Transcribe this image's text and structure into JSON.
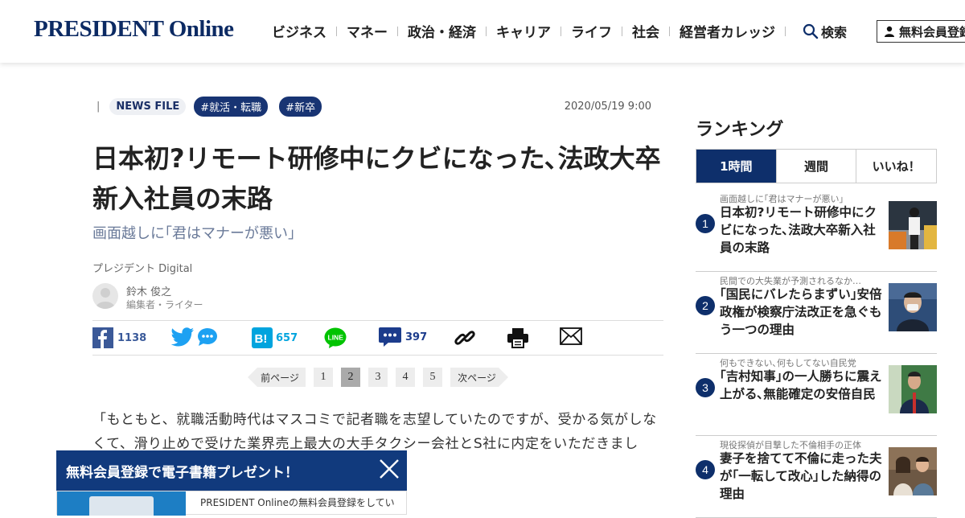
{
  "header": {
    "logo": "PRESIDENT Online",
    "nav": [
      "ビジネス",
      "マネー",
      "政治・経済",
      "キャリア",
      "ライフ",
      "社会",
      "経営者カレッジ"
    ],
    "search_label": "検索",
    "register_label": "無料会員登録"
  },
  "article": {
    "category": "NEWS FILE",
    "tags": [
      "#就活・転職",
      "#新卒"
    ],
    "date": "2020/05/19 9:00",
    "title": "日本初?リモート研修中にクビになった､法政大卒新入社員の末路",
    "subtitle": "画面越しに｢君はマナーが悪い｣",
    "source": "プレジデント Digital",
    "author_name": "鈴木 俊之",
    "author_role": "編集者・ライター",
    "body": "「もともと、就職活動時代はマスコミで記者職を志望していたのですが、受かる気がしなくて、滑り止めで受けた業界売上最大の大手タクシー会社とS社に内定をいただきまし"
  },
  "share": {
    "facebook_count": "1138",
    "hatena_count": "657",
    "comment_count": "397",
    "line_label": "LINE"
  },
  "pager": {
    "prev": "前ページ",
    "next": "次ページ",
    "pages": [
      "1",
      "2",
      "3",
      "4",
      "5"
    ],
    "current": "2"
  },
  "popup": {
    "title": "無料会員登録で電子書籍プレゼント！",
    "text": "PRESIDENT Onlineの無料会員登録をしてい"
  },
  "ranking": {
    "title": "ランキング",
    "tabs": [
      "1時間",
      "週間",
      "いいね！"
    ],
    "items": [
      {
        "num": "1",
        "sub": "画面越しに｢君はマナーが悪い｣",
        "title": "日本初?リモート研修中にクビになった､法政大卒新入社員の末路"
      },
      {
        "num": "2",
        "sub": "民間での大失業が予測されるなか…",
        "title": "｢国民にバレたらまずい｣安倍政権が検察庁法改正を急ぐもう一つの理由"
      },
      {
        "num": "3",
        "sub": "何もできない､何もしてない自民党",
        "title": "｢吉村知事｣の一人勝ちに震え上がる､無能確定の安倍自民"
      },
      {
        "num": "4",
        "sub": "現役探偵が目撃した不倫相手の正体",
        "title": "妻子を捨てて不倫に走った夫が｢一転して改心｣した納得の理由"
      }
    ]
  },
  "colors": {
    "brand_navy": "#0e2f6b",
    "tag_bg": "#183473",
    "facebook": "#3b5998",
    "twitter": "#1da1f2",
    "hatena": "#00a4de",
    "line": "#00c300",
    "comment": "#1c3c8c"
  }
}
